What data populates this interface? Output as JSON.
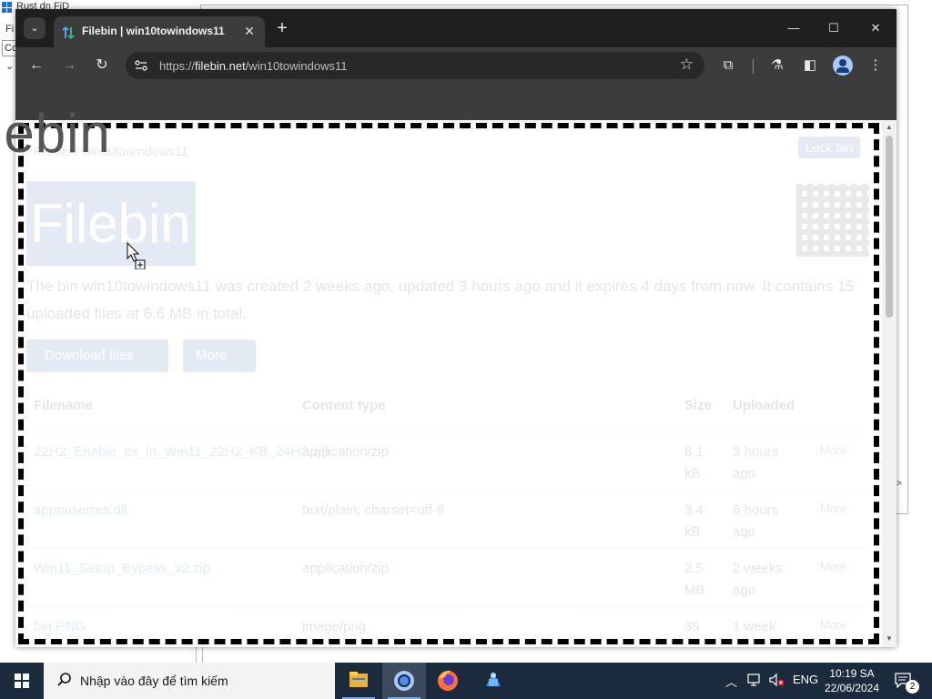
{
  "background_window": {
    "title": "Rust dn FiD",
    "menu": "Fi",
    "address": "Co",
    "help": "?"
  },
  "browser": {
    "tab_title": "Filebin | win10towindows11",
    "url_prefix": "https://",
    "url_domain": "filebin.net",
    "url_path": "/win10towindows11",
    "icons": [
      "tab-search-icon",
      "favicon-icon",
      "close-tab-icon",
      "new-tab-icon",
      "minimize-icon",
      "maximize-icon",
      "close-window-icon",
      "back-icon",
      "forward-icon",
      "reload-icon",
      "site-info-icon",
      "bookmark-star-icon",
      "extensions-icon",
      "labs-icon",
      "side-panel-icon",
      "profile-icon",
      "menu-icon"
    ]
  },
  "page": {
    "breadcrumb": "Filebin / win10towindows11",
    "lock_label": "Lock bin",
    "logo_text": "Filebin",
    "description": "The bin win10towindows11 was created 2 weeks ago, updated 3 hours ago and it expires 4 days from now. It contains 15 uploaded files at 6.6 MB in total.",
    "download_button": "Download files",
    "more_button": "More",
    "columns": [
      "Filename",
      "Content type",
      "Size",
      "Uploaded"
    ],
    "rows": [
      {
        "filename": "22H2_Enable_ex_in_Win11_22H2_KB_24H2.zip",
        "type": "application/zip",
        "size": "8.1 kB",
        "uploaded": "3 hours ago",
        "more": "More"
      },
      {
        "filename": "appraiserres.dll",
        "type": "text/plain; charset=utf-8",
        "size": "3.4 kB",
        "uploaded": "6 hours ago",
        "more": "More"
      },
      {
        "filename": "Win11_Setup_Bypass_v2.zip",
        "type": "application/zip",
        "size": "2.5 MB",
        "uploaded": "2 weeks ago",
        "more": "More"
      },
      {
        "filename": "bin.PNG",
        "type": "image/png",
        "size": "35",
        "uploaded": "1 week",
        "more": "More"
      }
    ]
  },
  "ghost_text": "iebin",
  "taskbar": {
    "search_placeholder": "Nhập vào đây để tìm kiếm",
    "language": "ENG",
    "time": "10:19 SA",
    "date": "22/06/2024",
    "notification_count": "2"
  },
  "colors": {
    "chrome_dark": "#202124",
    "taskbar": "#1b2a3d",
    "accent": "#2a5caa"
  }
}
